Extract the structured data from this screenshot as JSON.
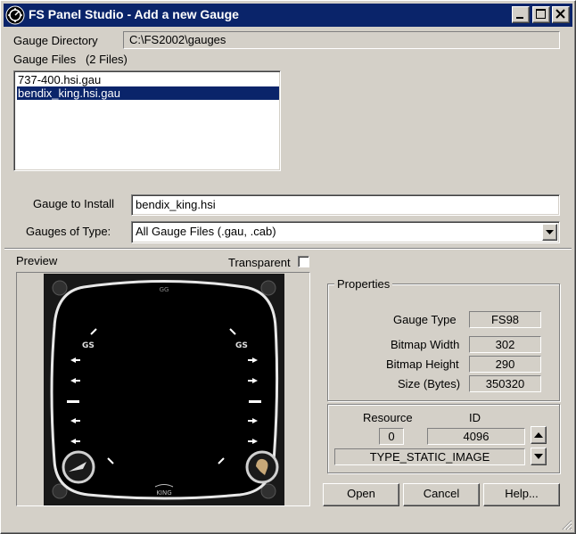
{
  "window": {
    "title": "FS Panel Studio - Add a new Gauge",
    "icons": {
      "app": "fs-panel-studio-icon",
      "minimize": "minimize-icon",
      "maximize": "maximize-icon",
      "close": "close-icon"
    }
  },
  "gauge_directory": {
    "label": "Gauge Directory",
    "value": "C:\\FS2002\\gauges"
  },
  "gauge_files": {
    "label": "Gauge Files",
    "count_text": "(2 Files)",
    "items": [
      {
        "name": "737-400.hsi.gau",
        "selected": false
      },
      {
        "name": "bendix_king.hsi.gau",
        "selected": true
      }
    ]
  },
  "gauge_to_install": {
    "label": "Gauge to Install",
    "value": "bendix_king.hsi"
  },
  "gauges_of_type": {
    "label": "Gauges of Type:",
    "value": "All Gauge Files (.gau, .cab)"
  },
  "preview": {
    "label": "Preview",
    "transparent_label": "Transparent",
    "transparent_checked": false,
    "gauge_markings": {
      "left_gs": "GS",
      "right_gs": "GS",
      "brand": "KING"
    }
  },
  "properties": {
    "title": "Properties",
    "gauge_type": {
      "label": "Gauge Type",
      "value": "FS98"
    },
    "bitmap_width": {
      "label": "Bitmap Width",
      "value": "302"
    },
    "bitmap_height": {
      "label": "Bitmap Height",
      "value": "290"
    },
    "size": {
      "label": "Size (Bytes)",
      "value": "350320"
    }
  },
  "resource": {
    "resource_label": "Resource",
    "id_label": "ID",
    "resource_value": "0",
    "id_value": "4096",
    "type_value": "TYPE_STATIC_IMAGE"
  },
  "buttons": {
    "open": "Open",
    "cancel": "Cancel",
    "help": "Help..."
  },
  "colors": {
    "titlebar": "#0a246a",
    "face": "#d4d0c8",
    "selection": "#0a246a"
  }
}
